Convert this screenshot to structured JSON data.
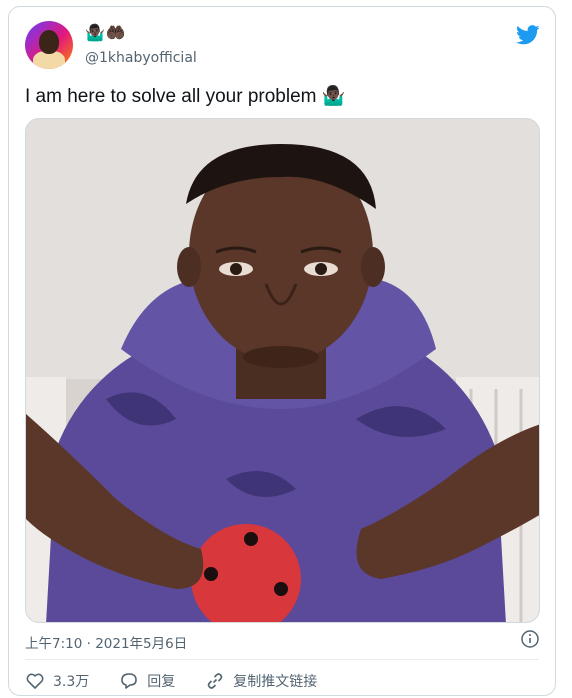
{
  "user": {
    "name_emoji": "🤷🏿‍♂️🤲🏿",
    "handle": "@1khabyofficial"
  },
  "tweet": {
    "text": "I am here to solve all your problem 🤷🏿‍♂️"
  },
  "meta": {
    "timestamp": "上午7:10 · 2021年5月6日"
  },
  "actions": {
    "likes": "3.3万",
    "reply": "回复",
    "copy_link": "复制推文链接"
  },
  "icons": [
    "twitter-bird-icon",
    "info-icon",
    "heart-icon",
    "reply-bubble-icon",
    "link-icon"
  ],
  "colors": {
    "brand": "#1d9bf0",
    "secondary_text": "#536471",
    "border": "#cfd9de"
  }
}
